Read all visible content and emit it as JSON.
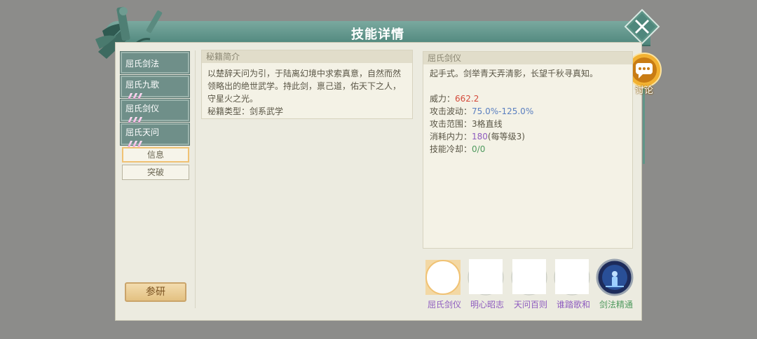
{
  "window": {
    "title": "技能详情"
  },
  "discuss": {
    "label": "讨论"
  },
  "left": {
    "tabs": [
      {
        "label": "屈氏剑法",
        "marks": 0
      },
      {
        "label": "屈氏九歌",
        "marks": 3
      },
      {
        "label": "屈氏剑仪",
        "marks": 3
      },
      {
        "label": "屈氏天问",
        "marks": 3
      }
    ],
    "info_label": "信息",
    "break_label": "突破",
    "research_label": "参研"
  },
  "intro": {
    "heading": "秘籍简介",
    "text": "以楚辞天问为引，于陆离幻境中求索真意，自然而然领略出的绝世武学。持此剑，禀己道，佑天下之人，守星火之光。",
    "type_label": "秘籍类型：",
    "type_value": "剑系武学"
  },
  "detail": {
    "heading": "屈氏剑仪",
    "description": "起手式。剑举青天弄清影，长望千秋寻真知。",
    "power_label": "威力：",
    "power_value": "662.2",
    "wave_label": "攻击波动：",
    "wave_value": "75.0%-125.0%",
    "range_label": "攻击范围：",
    "range_value": "3格直线",
    "cost_label": "消耗内力：",
    "cost_value": "180",
    "cost_extra": "(每等级3)",
    "cooldown_label": "技能冷却：",
    "cooldown_value": "0/0"
  },
  "skills": [
    {
      "name": "屈氏剑仪",
      "color": "#8e5bbf"
    },
    {
      "name": "明心昭志",
      "color": "#8e5bbf"
    },
    {
      "name": "天问百则",
      "color": "#8e5bbf"
    },
    {
      "name": "谁踏歌和",
      "color": "#8e5bbf"
    },
    {
      "name": "剑法精通",
      "color": "#4f9a5e"
    }
  ],
  "colors": {
    "title_bar": "#5f9688",
    "panel": "#ecebe0",
    "accent_gold": "#f0c274"
  },
  "icons": [
    "sword-decoration-icon",
    "close-icon",
    "chat-bubble-icon",
    "swordsman-icon"
  ]
}
